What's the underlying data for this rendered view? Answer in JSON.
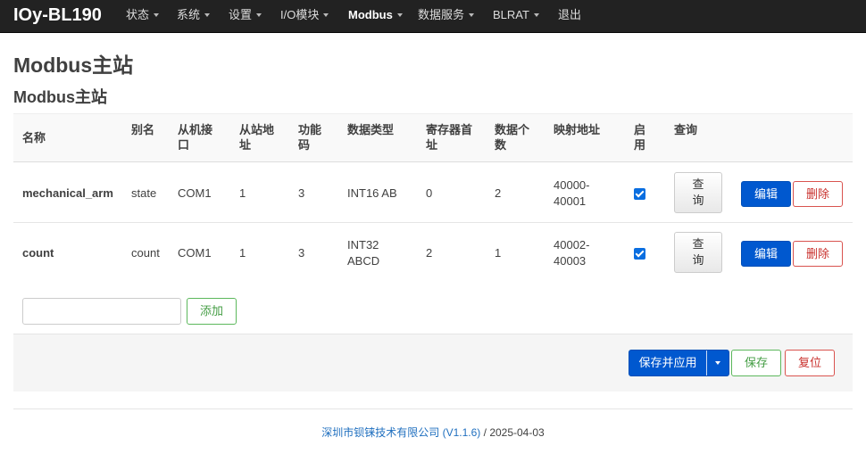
{
  "navbar": {
    "brand": "IOy-BL190",
    "items": [
      {
        "label": "状态",
        "dropdown": true
      },
      {
        "label": "系统",
        "dropdown": true
      },
      {
        "label": "设置",
        "dropdown": true
      },
      {
        "label": "I/O模块",
        "dropdown": true
      },
      {
        "label": "Modbus",
        "dropdown": true
      },
      {
        "label": "数据服务",
        "dropdown": true
      },
      {
        "label": "BLRAT",
        "dropdown": true
      },
      {
        "label": "退出",
        "dropdown": false
      }
    ]
  },
  "page": {
    "title": "Modbus主站",
    "section_title": "Modbus主站"
  },
  "table": {
    "headers": {
      "name": "名称",
      "alias": "别名",
      "port_1": "从机接",
      "port_2": "口",
      "slave_1": "从站地",
      "slave_2": "址",
      "func_1": "功能",
      "func_2": "码",
      "dtype": "数据类型",
      "reg_1": "寄存器首",
      "reg_2": "址",
      "count_1": "数据个",
      "count_2": "数",
      "map": "映射地址",
      "enable_1": "启",
      "enable_2": "用",
      "query": "查询"
    },
    "rows": [
      {
        "name": "mechanical_arm",
        "alias": "state",
        "port": "COM1",
        "slave": "1",
        "func": "3",
        "dtype_1": "INT16 AB",
        "dtype_2": "",
        "reg": "0",
        "count": "2",
        "map_1": "40000-",
        "map_2": "40001",
        "enabled": true,
        "query_1": "查",
        "query_2": "询",
        "edit": "编辑",
        "delete": "删除"
      },
      {
        "name": "count",
        "alias": "count",
        "port": "COM1",
        "slave": "1",
        "func": "3",
        "dtype_1": "INT32",
        "dtype_2": "ABCD",
        "reg": "2",
        "count": "1",
        "map_1": "40002-",
        "map_2": "40003",
        "enabled": true,
        "query_1": "查",
        "query_2": "询",
        "edit": "编辑",
        "delete": "删除"
      }
    ]
  },
  "add": {
    "input_value": "",
    "button": "添加"
  },
  "actions": {
    "save_apply": "保存并应用",
    "save": "保存",
    "reset": "复位"
  },
  "footer": {
    "company": "深圳市钡铼技术有限公司 (V1.1.6)",
    "date": " / 2025-04-03"
  },
  "colors": {
    "primary": "#0058cf",
    "success": "#5cb85c",
    "danger": "#d9534f",
    "navbar": "#222222"
  }
}
